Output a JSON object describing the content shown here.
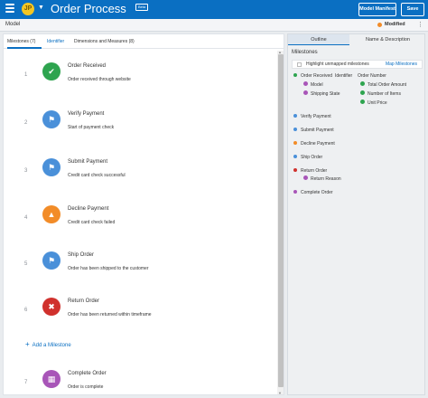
{
  "header": {
    "logo_text": "JP",
    "title": "Order Process",
    "badge": "Beta",
    "model_manifest_label": "Model Manifest",
    "save_label": "Save"
  },
  "toolbar": {
    "model_label": "Model",
    "status_label": "Modified",
    "status_color": "#f28c28"
  },
  "tabs": [
    {
      "label": "Milestones (7)"
    },
    {
      "label": "Identifier"
    },
    {
      "label": "Dimensions and Measures (8)"
    }
  ],
  "milestones": [
    {
      "num": "1",
      "name": "Order Received",
      "desc": "Order received through website",
      "icon": "check-icon",
      "color": "#2ea44f"
    },
    {
      "num": "2",
      "name": "Verify Payment",
      "desc": "Start of payment check",
      "icon": "flag-icon",
      "color": "#4a90d9"
    },
    {
      "num": "3",
      "name": "Submit Payment",
      "desc": "Credit card check successful",
      "icon": "flag-icon",
      "color": "#4a90d9"
    },
    {
      "num": "4",
      "name": "Decline Payment",
      "desc": "Credit card check failed",
      "icon": "warning-icon",
      "color": "#f28c28"
    },
    {
      "num": "5",
      "name": "Ship Order",
      "desc": "Order has been shipped to the customer",
      "icon": "flag-icon",
      "color": "#4a90d9"
    },
    {
      "num": "6",
      "name": "Return Order",
      "desc": "Order has been returned within timeframe",
      "icon": "close-icon",
      "color": "#d0312d"
    },
    {
      "num": "7",
      "name": "Complete Order",
      "desc": "Order is complete",
      "icon": "checkered-flag-icon",
      "color": "#a855b8"
    }
  ],
  "add_milestone_label": "Add a Milestone",
  "right_panel": {
    "tabs": [
      {
        "label": "Outline"
      },
      {
        "label": "Name & Description"
      }
    ],
    "section_title": "Milestones",
    "highlight_label": "Highlight unmapped milestones",
    "map_label": "Map Milestones",
    "outline": {
      "order_received": "Order Received",
      "identifier": "Identifier",
      "order_number": "Order Number",
      "model": "Model",
      "shipping_state": "Shipping State",
      "total_order_amount": "Total Order Amount",
      "number_of_items": "Number of Items",
      "unit_price": "Unit Price",
      "verify_payment": "Verify Payment",
      "submit_payment": "Submit Payment",
      "decline_payment": "Decline Payment",
      "ship_order": "Ship Order",
      "return_order": "Return Order",
      "return_reason": "Return Reason",
      "complete_order": "Complete Order"
    }
  }
}
